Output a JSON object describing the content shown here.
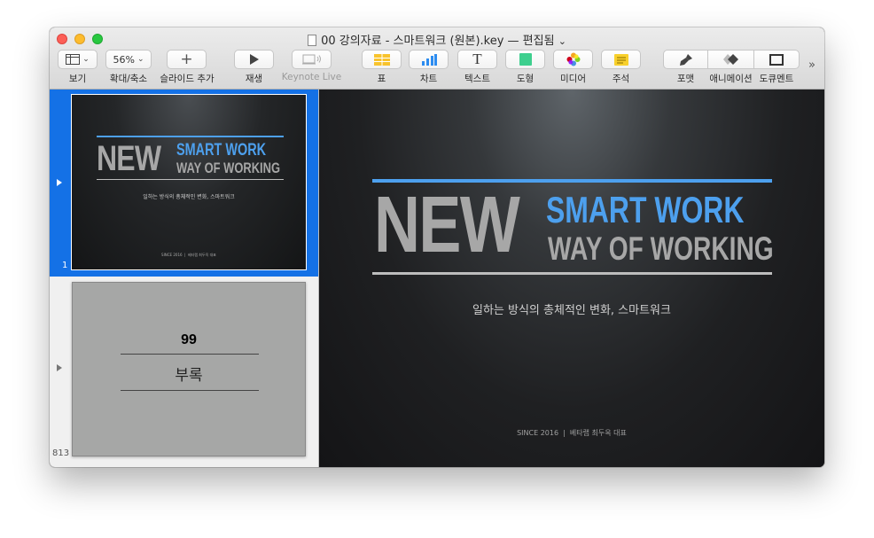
{
  "window": {
    "title": "00 강의자료 - 스마트워크 (원본).key — 편집됨",
    "title_chevron": "⌄"
  },
  "toolbar": {
    "view_label": "보기",
    "zoom_value": "56%",
    "zoom_label": "확대/축소",
    "add_slide_label": "슬라이드 추가",
    "play_label": "재생",
    "keynote_live_label": "Keynote Live",
    "table_label": "표",
    "chart_label": "차트",
    "text_label": "텍스트",
    "shape_label": "도형",
    "media_label": "미디어",
    "comment_label": "주석",
    "format_label": "포맷",
    "animate_label": "애니메이션",
    "document_label": "도큐멘트",
    "more": "»"
  },
  "navigator": {
    "slides": [
      {
        "number": "1",
        "selected": true
      },
      {
        "number": "813",
        "selected": false,
        "heading": "99",
        "subtitle": "부록"
      }
    ]
  },
  "slide": {
    "new_word": "NEW",
    "line1": "SMART WORK",
    "line2": "WAY OF WORKING",
    "subtitle": "일하는 방식의 총체적인 변화, 스마트워크",
    "footer": "SINCE 2016  |  베타랩 최두옥 대표",
    "colors": {
      "accent": "#4da0ee",
      "gray_text": "#a7a7a7",
      "rule": "#bdbdbd"
    }
  }
}
